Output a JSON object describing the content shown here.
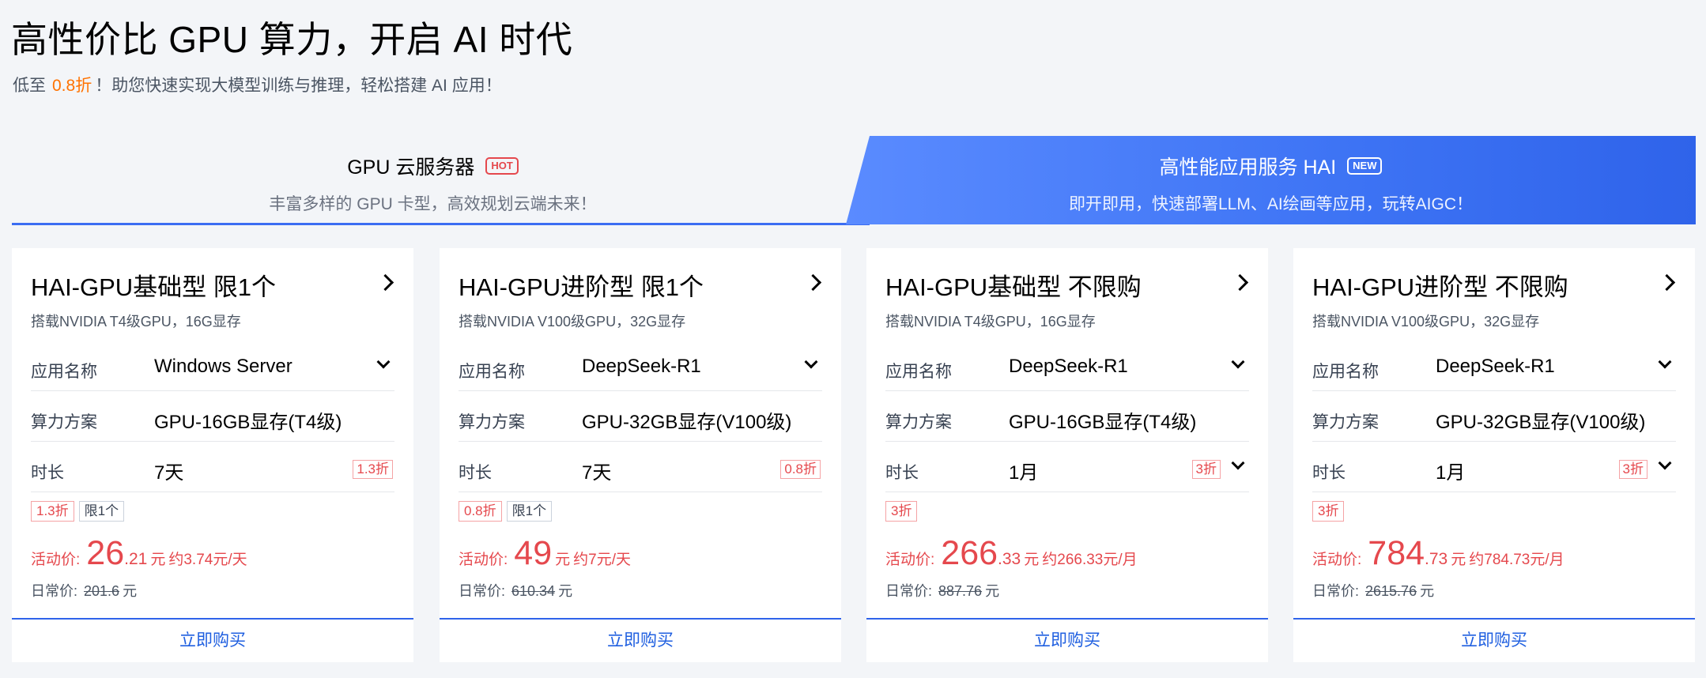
{
  "hero": {
    "title": "高性价比 GPU 算力，开启 AI 时代",
    "sub_prefix": "低至",
    "sub_highlight": "0.8折",
    "sub_rest": "！助您快速实现大模型训练与推理，轻松搭建 AI 应用！"
  },
  "tabs": [
    {
      "title": "GPU 云服务器",
      "badge": "HOT",
      "sub": "丰富多样的 GPU 卡型，高效规划云端未来！",
      "active": false
    },
    {
      "title": "高性能应用服务 HAI",
      "badge": "NEW",
      "sub": "即开即用，快速部署LLM、AI绘画等应用，玩转AIGC！",
      "active": true
    }
  ],
  "labels": {
    "app_name": "应用名称",
    "compute_plan": "算力方案",
    "duration": "时长",
    "promo_price": "活动价:",
    "regular_price": "日常价:",
    "currency": "元",
    "buy": "立即购买"
  },
  "colors": {
    "accent_blue": "#2f63ea",
    "price_red": "#e5484d",
    "highlight_orange": "#ff7200"
  },
  "cards": [
    {
      "title": "HAI-GPU基础型 限1个",
      "desc": "搭载NVIDIA T4级GPU，16G显存",
      "app": "Windows Server",
      "plan": "GPU-16GB显存(T4级)",
      "duration": "7天",
      "duration_discount": "1.3折",
      "tags": [
        "1.3折",
        "限1个"
      ],
      "price_int": "26",
      "price_dec": ".21",
      "per": "约3.74元/天",
      "orig": "201.6"
    },
    {
      "title": "HAI-GPU进阶型 限1个",
      "desc": "搭载NVIDIA V100级GPU，32G显存",
      "app": "DeepSeek-R1",
      "plan": "GPU-32GB显存(V100级)",
      "duration": "7天",
      "duration_discount": "0.8折",
      "tags": [
        "0.8折",
        "限1个"
      ],
      "price_int": "49",
      "price_dec": "",
      "per": "约7元/天",
      "orig": "610.34"
    },
    {
      "title": "HAI-GPU基础型 不限购",
      "desc": "搭载NVIDIA T4级GPU，16G显存",
      "app": "DeepSeek-R1",
      "plan": "GPU-16GB显存(T4级)",
      "duration": "1月",
      "duration_discount": "3折",
      "tags": [
        "3折"
      ],
      "price_int": "266",
      "price_dec": ".33",
      "per": "约266.33元/月",
      "orig": "887.76"
    },
    {
      "title": "HAI-GPU进阶型 不限购",
      "desc": "搭载NVIDIA V100级GPU，32G显存",
      "app": "DeepSeek-R1",
      "plan": "GPU-32GB显存(V100级)",
      "duration": "1月",
      "duration_discount": "3折",
      "tags": [
        "3折"
      ],
      "price_int": "784",
      "price_dec": ".73",
      "per": "约784.73元/月",
      "orig": "2615.76"
    }
  ]
}
